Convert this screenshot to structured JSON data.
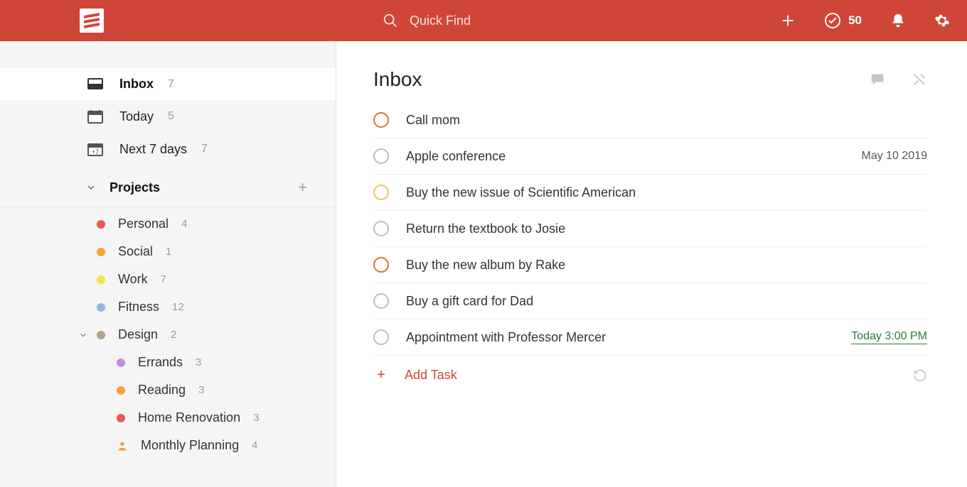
{
  "header": {
    "search_placeholder": "Quick Find",
    "karma_score": "50"
  },
  "sidebar": {
    "filters": [
      {
        "id": "inbox",
        "label": "Inbox",
        "count": "7",
        "active": true
      },
      {
        "id": "today",
        "label": "Today",
        "count": "5",
        "active": false
      },
      {
        "id": "week",
        "label": "Next 7 days",
        "count": "7",
        "active": false
      }
    ],
    "projects_label": "Projects",
    "projects": [
      {
        "label": "Personal",
        "count": "4",
        "color": "#e9594c"
      },
      {
        "label": "Social",
        "count": "1",
        "color": "#f1a33c"
      },
      {
        "label": "Work",
        "count": "7",
        "color": "#f3e24d"
      },
      {
        "label": "Fitness",
        "count": "12",
        "color": "#8fb7e4"
      },
      {
        "label": "Design",
        "count": "2",
        "color": "#b2a28a",
        "expanded": true
      }
    ],
    "design_children": [
      {
        "label": "Errands",
        "count": "3",
        "color": "#c58ade"
      },
      {
        "label": "Reading",
        "count": "3",
        "color": "#f1a33c"
      },
      {
        "label": "Home Renovation",
        "count": "3",
        "color": "#e9594c"
      },
      {
        "label": "Monthly Planning",
        "count": "4",
        "person": true
      }
    ]
  },
  "main": {
    "title": "Inbox",
    "add_task_label": "Add Task",
    "tasks": [
      {
        "title": "Call mom",
        "priority": "p1",
        "due": ""
      },
      {
        "title": "Apple conference",
        "priority": "",
        "due": "May 10 2019"
      },
      {
        "title": "Buy the new issue of Scientific American",
        "priority": "p2",
        "due": ""
      },
      {
        "title": "Return the textbook to Josie",
        "priority": "",
        "due": ""
      },
      {
        "title": "Buy the new album by Rake",
        "priority": "p1",
        "due": ""
      },
      {
        "title": "Buy a gift card for Dad",
        "priority": "",
        "due": ""
      },
      {
        "title": "Appointment with Professor Mercer",
        "priority": "",
        "due": "Today 3:00 PM",
        "due_today": true
      }
    ]
  }
}
